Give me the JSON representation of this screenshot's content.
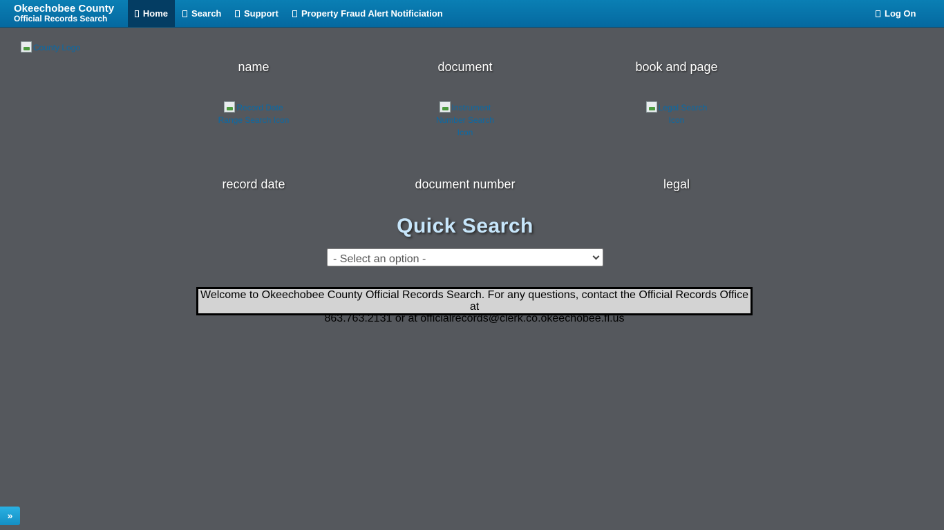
{
  "header": {
    "brand_line1": "Okeechobee County",
    "brand_line2": "Official Records Search"
  },
  "nav": {
    "home": "Home",
    "search": "Search",
    "support": "Support",
    "fraud": "Property Fraud Alert Notificiation",
    "logon": "Log On"
  },
  "logo_alt": "County Logo",
  "search_types": {
    "top": [
      "name",
      "document",
      "book and page"
    ],
    "icons": [
      "Record Date Range Search Icon",
      "Instrument Number Search Icon",
      "Legal Search Icon"
    ],
    "bottom": [
      "record date",
      "document number",
      "legal"
    ]
  },
  "quick_search": {
    "title": "Quick Search",
    "selected": "- Select an option -"
  },
  "welcome": {
    "line1": "Welcome to Okeechobee County Official Records Search. For any questions, contact the Official Records Office at",
    "line2": "863.763.2131 or at officialrecords@clerk.co.okeechobee.fl.us"
  },
  "corner_button": "»",
  "colors": {
    "background": "#55585d",
    "navbar": "#0569a0",
    "title": "#c7e6fb"
  }
}
